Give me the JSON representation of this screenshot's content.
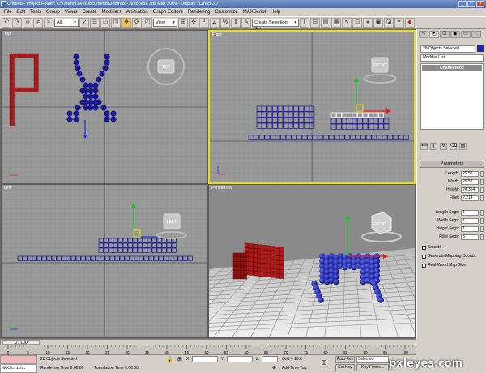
{
  "window": {
    "title": "Untitled     - Project Folder: C:\\Users\\Love\\Documents\\3dsmax     - Autodesk 3ds Max 2009          - Display : Direct 3D",
    "min": "_",
    "max": "□",
    "close": "×"
  },
  "menu": [
    "File",
    "Edit",
    "Tools",
    "Group",
    "Views",
    "Create",
    "Modifiers",
    "Animation",
    "Graph Editors",
    "Rendering",
    "Customize",
    "MAXScript",
    "Help"
  ],
  "toolbar": {
    "filter_value": "All",
    "coord_value": "View",
    "named_selection_placeholder": "Create Selection Set",
    "dropdown_arrow": "▾"
  },
  "viewports": {
    "top": {
      "label": "Top",
      "cube": "TOP"
    },
    "front": {
      "label": "Front",
      "cube": "FRONT"
    },
    "left": {
      "label": "Left",
      "cube": "LEFT"
    },
    "perspective": {
      "label": "Perspective",
      "cube": "FRONT"
    }
  },
  "command_panel": {
    "tabs": [
      "✎",
      "◩",
      "☐",
      "◉",
      "▭",
      "🔧"
    ],
    "selection_name": "28 Objects Selected",
    "modifier_list": "Modifier List",
    "stack_item": "ChamferBox",
    "stack_icons": [
      "⟸",
      "|",
      "∀",
      "⌫",
      "▤"
    ],
    "parameters_title": "Parameters",
    "params": [
      {
        "label": "Length:",
        "value": "29.52"
      },
      {
        "label": "Width:",
        "value": "29.52"
      },
      {
        "label": "Height:",
        "value": "24.354"
      },
      {
        "label": "Fillet:",
        "value": "2.214"
      },
      {
        "label": "Length Segs:",
        "value": "1"
      },
      {
        "label": "Width Segs:",
        "value": "1"
      },
      {
        "label": "Height Segs:",
        "value": "1"
      },
      {
        "label": "Fillet Segs:",
        "value": "3"
      }
    ],
    "checks": [
      {
        "label": "Smooth",
        "checked": true,
        "mark": "✓"
      },
      {
        "label": "Generate Mapping Coords.",
        "checked": true,
        "mark": "✓"
      },
      {
        "label": "Real-World Map Size",
        "checked": false,
        "mark": ""
      }
    ]
  },
  "timeline": {
    "slider_text": "0 / 100",
    "ticks": [
      "0",
      "5",
      "10",
      "15",
      "20",
      "25",
      "30",
      "35",
      "40",
      "45",
      "50",
      "55",
      "60",
      "65",
      "70",
      "75",
      "80",
      "85",
      "90",
      "95",
      "100"
    ]
  },
  "status": {
    "maxscript": "MAXScript.",
    "objects_selected": "28 Objects Selected",
    "rendering_time": "Rendering Time 0:00:00",
    "translation_time": "Translation Time 0:00:00",
    "x_label": "X:",
    "y_label": "Y:",
    "z_label": "Z:",
    "grid": "Grid = 10.0",
    "add_time_tag": "Add Time Tag",
    "auto_key": "Auto Key",
    "set_key": "Set Key",
    "selected": "Selected",
    "key_filters": "Key Filters..."
  },
  "watermark": "pxleyes.com",
  "colors": {
    "viewport_bg": "#9a9a9a",
    "active_border": "#f0e000",
    "grid_line": "#8a8a8a",
    "blue_obj": "#1a1a9a",
    "red_obj": "#b01818"
  }
}
